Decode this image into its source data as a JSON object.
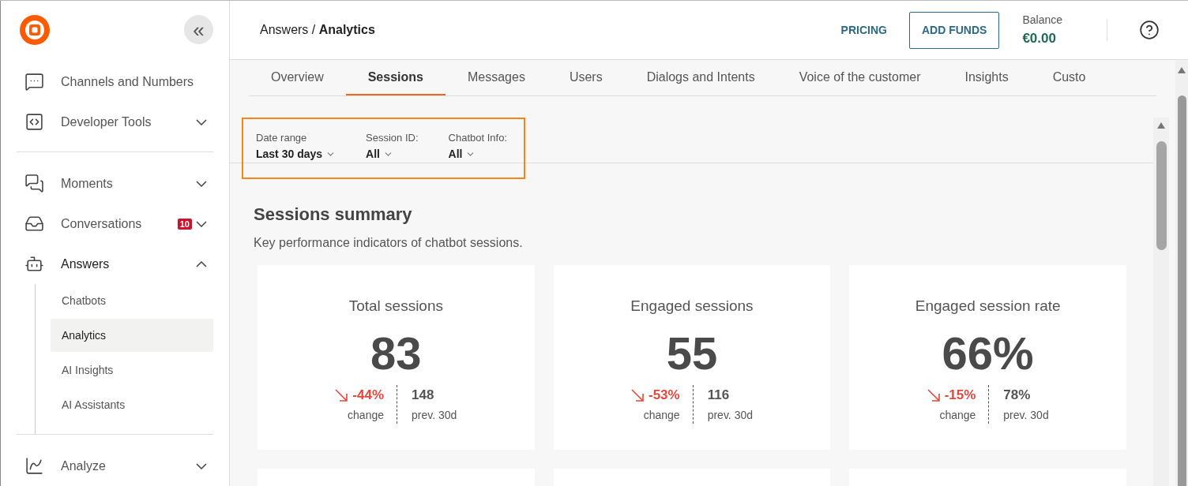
{
  "sidebar": {
    "collapse_button": "«",
    "nav_groups": [
      [
        {
          "label": "Channels and Numbers"
        },
        {
          "label": "Developer Tools",
          "expanded": false
        }
      ],
      [
        {
          "label": "Moments",
          "expanded": false
        },
        {
          "label": "Conversations",
          "expanded": false,
          "badge": "10"
        },
        {
          "label": "Answers",
          "expanded": true,
          "children": [
            {
              "label": "Chatbots",
              "selected": false
            },
            {
              "label": "Analytics",
              "selected": true
            },
            {
              "label": "AI Insights",
              "selected": false
            },
            {
              "label": "AI Assistants",
              "selected": false
            }
          ]
        }
      ],
      [
        {
          "label": "Analyze",
          "expanded": false
        }
      ]
    ]
  },
  "header": {
    "breadcrumb": "Answers / **Analytics**",
    "pricing": "PRICING",
    "add_funds": "ADD FUNDS",
    "balance_label": "Balance",
    "balance": "€0.00"
  },
  "tabs": [
    {
      "label": "Overview",
      "selected": false
    },
    {
      "label": "Sessions",
      "selected": true
    },
    {
      "label": "Messages",
      "selected": false
    },
    {
      "label": "Users",
      "selected": false
    },
    {
      "label": "Dialogs and Intents",
      "selected": false
    },
    {
      "label": "Voice of the customer",
      "selected": false
    },
    {
      "label": "Insights",
      "selected": false
    },
    {
      "label": "Custo",
      "selected": false
    }
  ],
  "filters": [
    {
      "label": "Date range",
      "value": "Last 30 days"
    },
    {
      "label": "Session ID:",
      "value": "All"
    },
    {
      "label": "Chatbot Info:",
      "value": "All"
    }
  ],
  "summary": {
    "title": "Sessions summary",
    "subtitle": "Key performance indicators of chatbot sessions.",
    "cards": [
      {
        "title": "Total sessions",
        "value": "83",
        "change": "-44%",
        "change_label": "change",
        "prev": "148",
        "prev_label": "prev. 30d"
      },
      {
        "title": "Engaged sessions",
        "value": "55",
        "change": "-53%",
        "change_label": "change",
        "prev": "116",
        "prev_label": "prev. 30d"
      },
      {
        "title": "Engaged session rate",
        "value": "66%",
        "change": "-15%",
        "change_label": "change",
        "prev": "78%",
        "prev_label": "prev. 30d"
      }
    ]
  }
}
